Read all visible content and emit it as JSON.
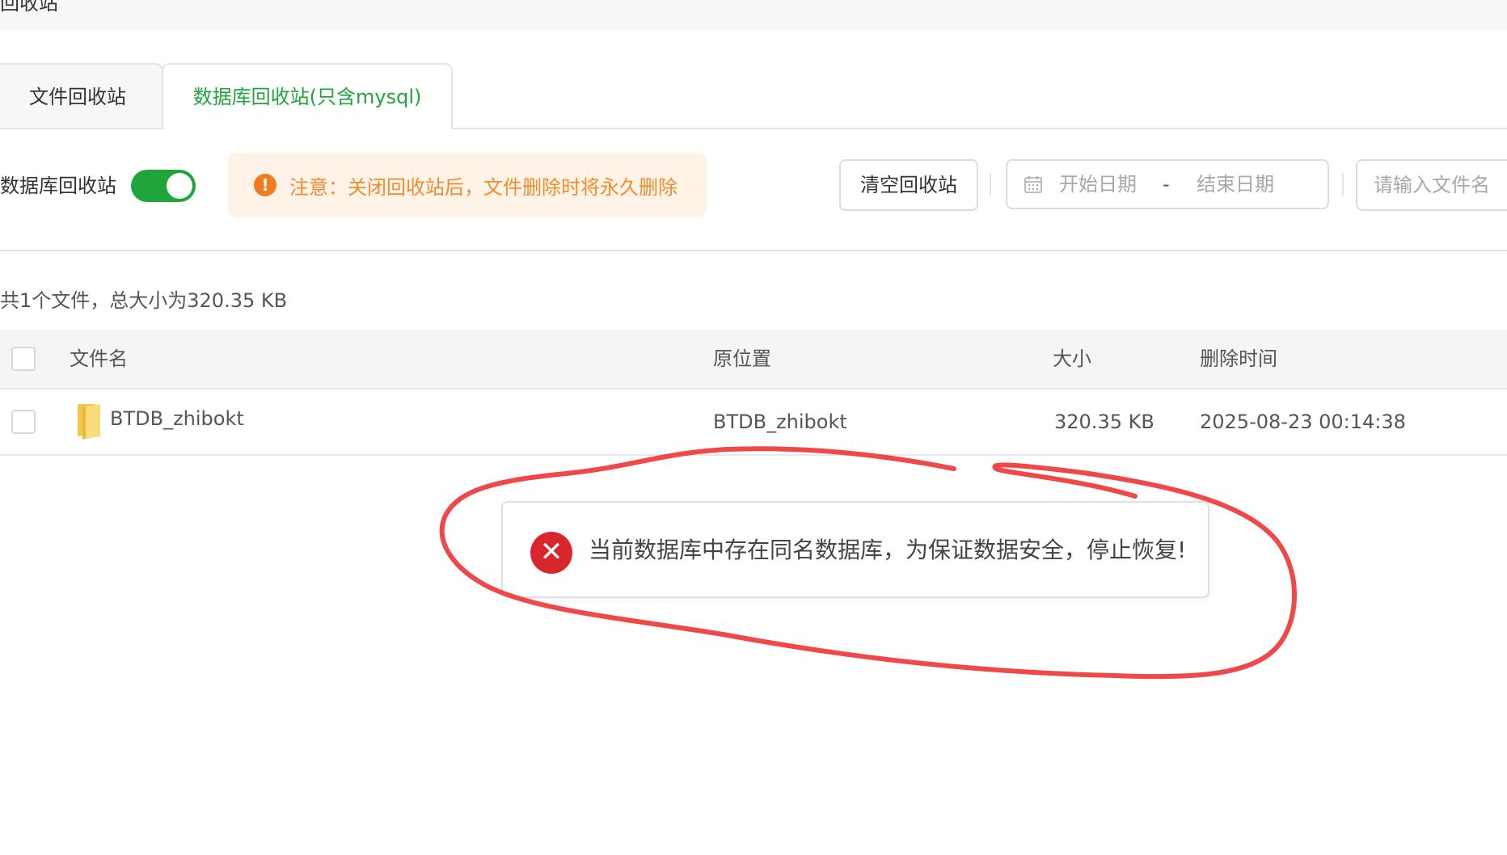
{
  "page": {
    "title": "回收站"
  },
  "tabs": [
    {
      "label": "文件回收站",
      "active": false
    },
    {
      "label": "数据库回收站(只含mysql)",
      "active": true
    }
  ],
  "toolbar": {
    "recycle_label": "数据库回收站",
    "recycle_enabled": true,
    "notice_text": "注意：关闭回收站后，文件删除时将永久删除",
    "clear_button": "清空回收站",
    "date_start_placeholder": "开始日期",
    "date_separator": "-",
    "date_end_placeholder": "结束日期",
    "search_placeholder": "请输入文件名"
  },
  "summary": "共1个文件，总大小为320.35 KB",
  "table": {
    "columns": [
      "文件名",
      "原位置",
      "大小",
      "删除时间"
    ],
    "rows": [
      {
        "name": "BTDB_zhibokt",
        "location": "BTDB_zhibokt",
        "size": "320.35 KB",
        "deleted_at": "2025-08-23 00:14:38"
      }
    ]
  },
  "toast": {
    "type": "error",
    "message": "当前数据库中存在同名数据库，为保证数据安全，停止恢复!"
  },
  "colors": {
    "accent": "#20a53a",
    "warning_bg": "#fff3e8",
    "warning_text": "#f08c2e",
    "error": "#d9262d",
    "annotation": "#f04848"
  },
  "icons": [
    "warning-icon",
    "calendar-icon",
    "folder-icon",
    "error-icon"
  ]
}
